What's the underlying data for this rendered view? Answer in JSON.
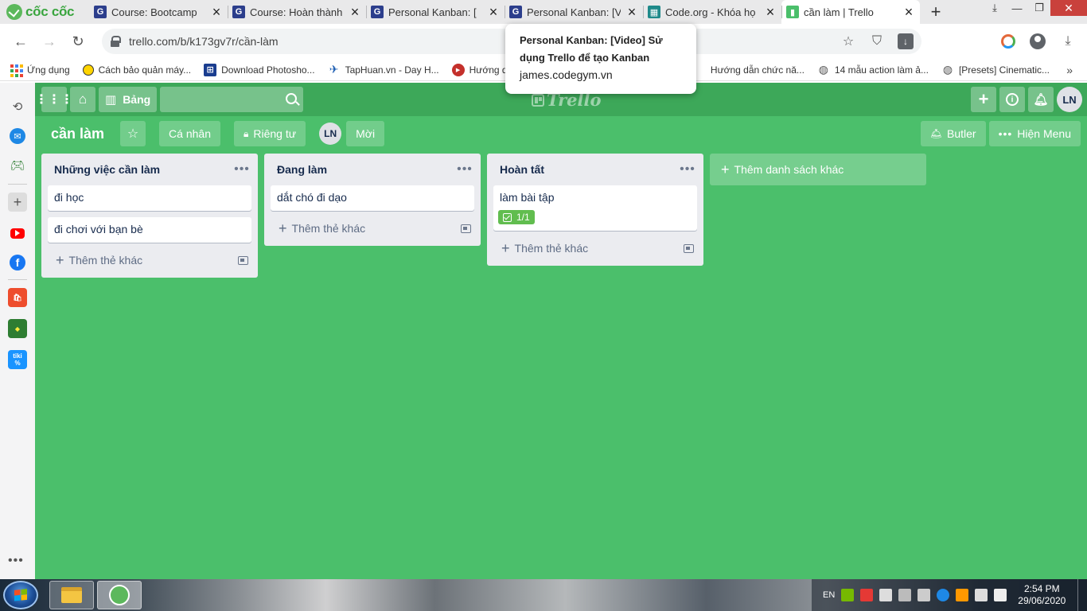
{
  "browser": {
    "brand": "cốc cốc",
    "tabs": [
      {
        "title": "Course: Bootcamp",
        "icon": "codegym-favicon"
      },
      {
        "title": "Course: Hoàn thành",
        "icon": "codegym-favicon"
      },
      {
        "title": "Personal Kanban: [",
        "icon": "codegym-favicon"
      },
      {
        "title": "Personal Kanban: [V",
        "icon": "codegym-favicon"
      },
      {
        "title": "Code.org - Khóa họ",
        "icon": "code-org-favicon"
      },
      {
        "title": "cần làm | Trello",
        "icon": "trello-favicon",
        "active": true
      }
    ],
    "url": "trello.com/b/k173gv7r/cần-làm",
    "tooltip": {
      "title": "Personal Kanban: [Video] Sử dụng Trello để tạo Kanban",
      "url": "james.codegym.vn"
    },
    "bookmarks": [
      {
        "label": "Ứng dụng",
        "icon": "apps-grid-icon"
      },
      {
        "label": "Cách bảo quản máy...",
        "icon": "bulb-icon"
      },
      {
        "label": "Download Photosho...",
        "icon": "grid-logo-icon"
      },
      {
        "label": "TapHuan.vn - Day H...",
        "icon": "bird-icon"
      },
      {
        "label": "Hướng dẫn",
        "icon": "youtube-icon"
      },
      {
        "label": "Hướng dẫn chức nă...",
        "icon": "hidden"
      },
      {
        "label": "14 mẫu action làm ả...",
        "icon": "globe-icon"
      },
      {
        "label": "[Presets] Cinematic...",
        "icon": "globe-icon"
      }
    ]
  },
  "trello": {
    "header": {
      "boards_label": "Bảng",
      "search_value": "",
      "logo_text": "Trello",
      "avatar_initials": "LN"
    },
    "board": {
      "title": "cần làm",
      "personal_label": "Cá nhân",
      "visibility_label": "Riêng tư",
      "member_initials": "LN",
      "invite_label": "Mời",
      "butler_label": "Butler",
      "menu_label": "Hiện Menu"
    },
    "lists": [
      {
        "title": "Những việc cần làm",
        "cards": [
          {
            "text": "đi học"
          },
          {
            "text": "đi chơi với bạn bè"
          }
        ],
        "add_card_label": "Thêm thẻ khác"
      },
      {
        "title": "Đang làm",
        "cards": [
          {
            "text": "dắt chó đi dạo"
          }
        ],
        "add_card_label": "Thêm thẻ khác"
      },
      {
        "title": "Hoàn tất",
        "cards": [
          {
            "text": "làm bài tập",
            "checklist": "1/1"
          }
        ],
        "add_card_label": "Thêm thẻ khác"
      }
    ],
    "add_list_label": "Thêm danh sách khác",
    "colors": {
      "board_bg": "#4bbf6b",
      "header_bg": "#3da859",
      "list_bg": "#ebecf0",
      "badge_done": "#61bd4f"
    }
  },
  "taskbar": {
    "language": "EN",
    "time": "2:54 PM",
    "date": "29/06/2020"
  }
}
